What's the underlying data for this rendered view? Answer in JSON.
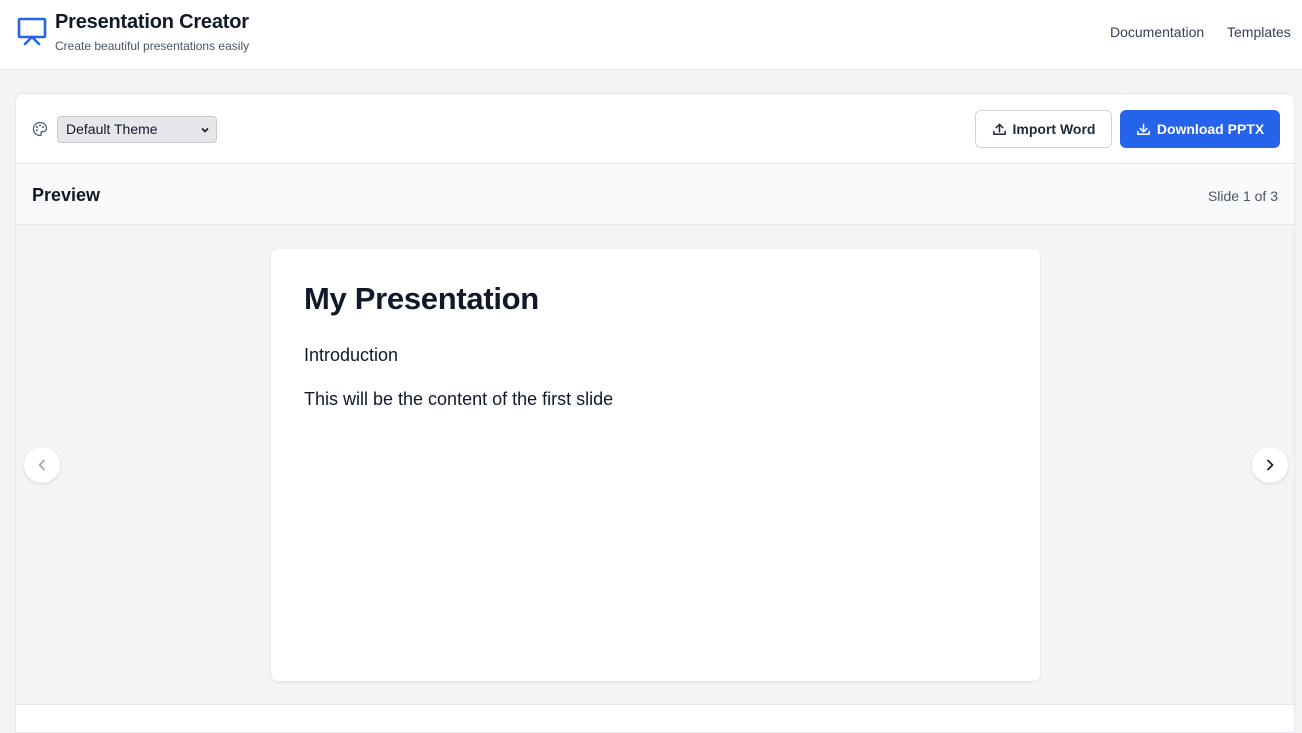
{
  "app": {
    "title": "Presentation Creator",
    "subtitle": "Create beautiful presentations easily",
    "logo_icon": "presentation-screen-icon",
    "accent_color": "#2563eb"
  },
  "nav": {
    "documentation": "Documentation",
    "templates": "Templates"
  },
  "toolbar": {
    "palette_icon": "palette-icon",
    "theme_select": {
      "selected": "Default Theme"
    },
    "import_label": "Import Word",
    "import_icon": "upload-icon",
    "download_label": "Download PPTX",
    "download_icon": "download-icon"
  },
  "preview": {
    "title": "Preview",
    "slide_counter": "Slide 1 of 3",
    "current_slide": 1,
    "total_slides": 3
  },
  "slide": {
    "title": "My Presentation",
    "lines": [
      "Introduction",
      "This will be the content of the first slide"
    ]
  },
  "navigation": {
    "prev_icon": "chevron-left-icon",
    "next_icon": "chevron-right-icon"
  }
}
